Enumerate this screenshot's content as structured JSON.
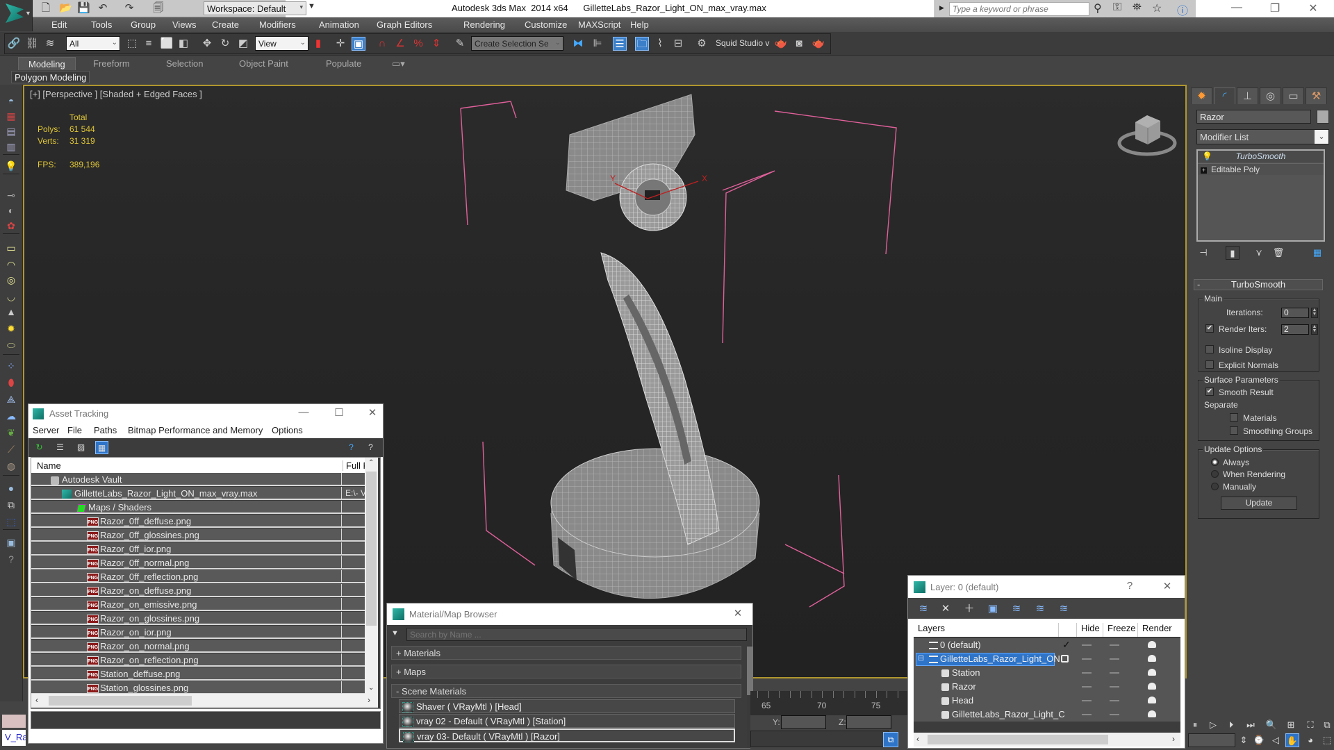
{
  "titlebar": {
    "app": "Autodesk 3ds Max  2014 x64",
    "file": "GilletteLabs_Razor_Light_ON_max_vray.max",
    "workspace": "Workspace: Default",
    "search_placeholder": "Type a keyword or phrase",
    "icons": [
      "new-icon",
      "open-icon",
      "save-icon",
      "undo-icon",
      "redo-icon",
      "project-folder-icon"
    ],
    "info_icons": [
      "binoculars-icon",
      "key-icon",
      "satellite-icon",
      "star-icon",
      "help-icon"
    ],
    "minimize": "—",
    "restore": "❐",
    "close": "✕"
  },
  "menu": [
    "Edit",
    "Tools",
    "Group",
    "Views",
    "Create",
    "Modifiers",
    "Animation",
    "Graph Editors",
    "Rendering",
    "Customize",
    "MAXScript",
    "Help"
  ],
  "toolbar": {
    "selection_filter": "All",
    "ref_coord": "View",
    "selection_set_placeholder": "Create Selection Se",
    "squid_label": "Squid Studio v"
  },
  "ribbon": {
    "tabs": [
      "Modeling",
      "Freeform",
      "Selection",
      "Object Paint",
      "Populate"
    ],
    "active_tab": "Modeling",
    "panel": "Polygon Modeling"
  },
  "viewport": {
    "label": "[+] [Perspective ] [Shaded + Edged Faces ]",
    "stats": {
      "header": "Total",
      "polys_label": "Polys:",
      "polys": "61 544",
      "verts_label": "Verts:",
      "verts": "31 319",
      "fps_label": "FPS:",
      "fps": "389,196"
    },
    "gizmo_axes": [
      "X",
      "Y"
    ],
    "border_color": "#b0962e",
    "bbox_color": "#e0609a"
  },
  "command_panel": {
    "tabs": [
      "create-tab",
      "modify-tab",
      "hierarchy-tab",
      "motion-tab",
      "display-tab",
      "utilities-tab"
    ],
    "object_name": "Razor",
    "modifier_list": "Modifier List",
    "stack": [
      "TurboSmooth",
      "Editable Poly"
    ],
    "turbosmooth": {
      "title": "TurboSmooth",
      "main_label": "Main",
      "iterations_label": "Iterations:",
      "iterations": "0",
      "render_iters_label": "Render Iters:",
      "render_iters": "2",
      "render_iters_checked": true,
      "isoline_label": "Isoline Display",
      "isoline_checked": false,
      "explicit_label": "Explicit Normals",
      "explicit_checked": false,
      "surface_label": "Surface Parameters",
      "smooth_result_label": "Smooth Result",
      "smooth_result_checked": true,
      "separate_label": "Separate",
      "materials_label": "Materials",
      "materials_checked": false,
      "smoothing_groups_label": "Smoothing Groups",
      "smoothing_groups_checked": false,
      "update_options_label": "Update Options",
      "always_label": "Always",
      "when_rendering_label": "When Rendering",
      "manually_label": "Manually",
      "selected_update": "Always",
      "update_button": "Update"
    }
  },
  "asset_tracking": {
    "title": "Asset Tracking",
    "menu": [
      "Server",
      "File",
      "Paths",
      "Bitmap Performance and Memory",
      "Options"
    ],
    "columns": [
      "Name",
      "Full P"
    ],
    "rows": [
      {
        "name": "Autodesk Vault",
        "path": "",
        "level": 1,
        "icon": "vault"
      },
      {
        "name": "GilletteLabs_Razor_Light_ON_max_vray.max",
        "path": "E:\\- V",
        "level": 2,
        "icon": "max"
      },
      {
        "name": "Maps / Shaders",
        "path": "",
        "level": 3,
        "icon": "maps"
      },
      {
        "name": "Razor_0ff_deffuse.png",
        "path": "",
        "level": 4,
        "icon": "png"
      },
      {
        "name": "Razor_0ff_glossines.png",
        "path": "",
        "level": 4,
        "icon": "png"
      },
      {
        "name": "Razor_0ff_ior.png",
        "path": "",
        "level": 4,
        "icon": "png"
      },
      {
        "name": "Razor_0ff_normal.png",
        "path": "",
        "level": 4,
        "icon": "png"
      },
      {
        "name": "Razor_0ff_reflection.png",
        "path": "",
        "level": 4,
        "icon": "png"
      },
      {
        "name": "Razor_on_deffuse.png",
        "path": "",
        "level": 4,
        "icon": "png"
      },
      {
        "name": "Razor_on_emissive.png",
        "path": "",
        "level": 4,
        "icon": "png"
      },
      {
        "name": "Razor_on_glossines.png",
        "path": "",
        "level": 4,
        "icon": "png"
      },
      {
        "name": "Razor_on_ior.png",
        "path": "",
        "level": 4,
        "icon": "png"
      },
      {
        "name": "Razor_on_normal.png",
        "path": "",
        "level": 4,
        "icon": "png"
      },
      {
        "name": "Razor_on_reflection.png",
        "path": "",
        "level": 4,
        "icon": "png"
      },
      {
        "name": "Station_deffuse.png",
        "path": "",
        "level": 4,
        "icon": "png"
      },
      {
        "name": "Station_glossines.png",
        "path": "",
        "level": 4,
        "icon": "png"
      }
    ],
    "png_badge": "PNG"
  },
  "material_browser": {
    "title": "Material/Map Browser",
    "search_placeholder": "Search by Name ...",
    "sections": [
      "+ Materials",
      "+ Maps",
      "-  Scene Materials"
    ],
    "items": [
      "Shaver ( VRayMtl ) [Head]",
      "vray 02 - Default ( VRayMtl ) [Station]",
      "vray 03- Default ( VRayMtl ) [Razor]"
    ],
    "selected_index": 2
  },
  "timeline": {
    "labels": [
      "65",
      "70",
      "75"
    ],
    "y_label": "Y:",
    "z_label": "Z:"
  },
  "layer_window": {
    "title": "Layer: 0 (default)",
    "help": "?",
    "close": "✕",
    "columns": [
      "Layers",
      "Hide",
      "Freeze",
      "Render"
    ],
    "rows": [
      {
        "name": "0 (default)",
        "type": "layer",
        "current": true
      },
      {
        "name": "GilletteLabs_Razor_Light_ON",
        "type": "layer",
        "selected": true,
        "expanded": true
      },
      {
        "name": "Station",
        "type": "object"
      },
      {
        "name": "Razor",
        "type": "object"
      },
      {
        "name": "Head",
        "type": "object"
      },
      {
        "name": "GilletteLabs_Razor_Light_C",
        "type": "object"
      }
    ]
  },
  "maxscript_listener": {
    "text": "V_Ra"
  },
  "accent_color": "#2e74c8"
}
